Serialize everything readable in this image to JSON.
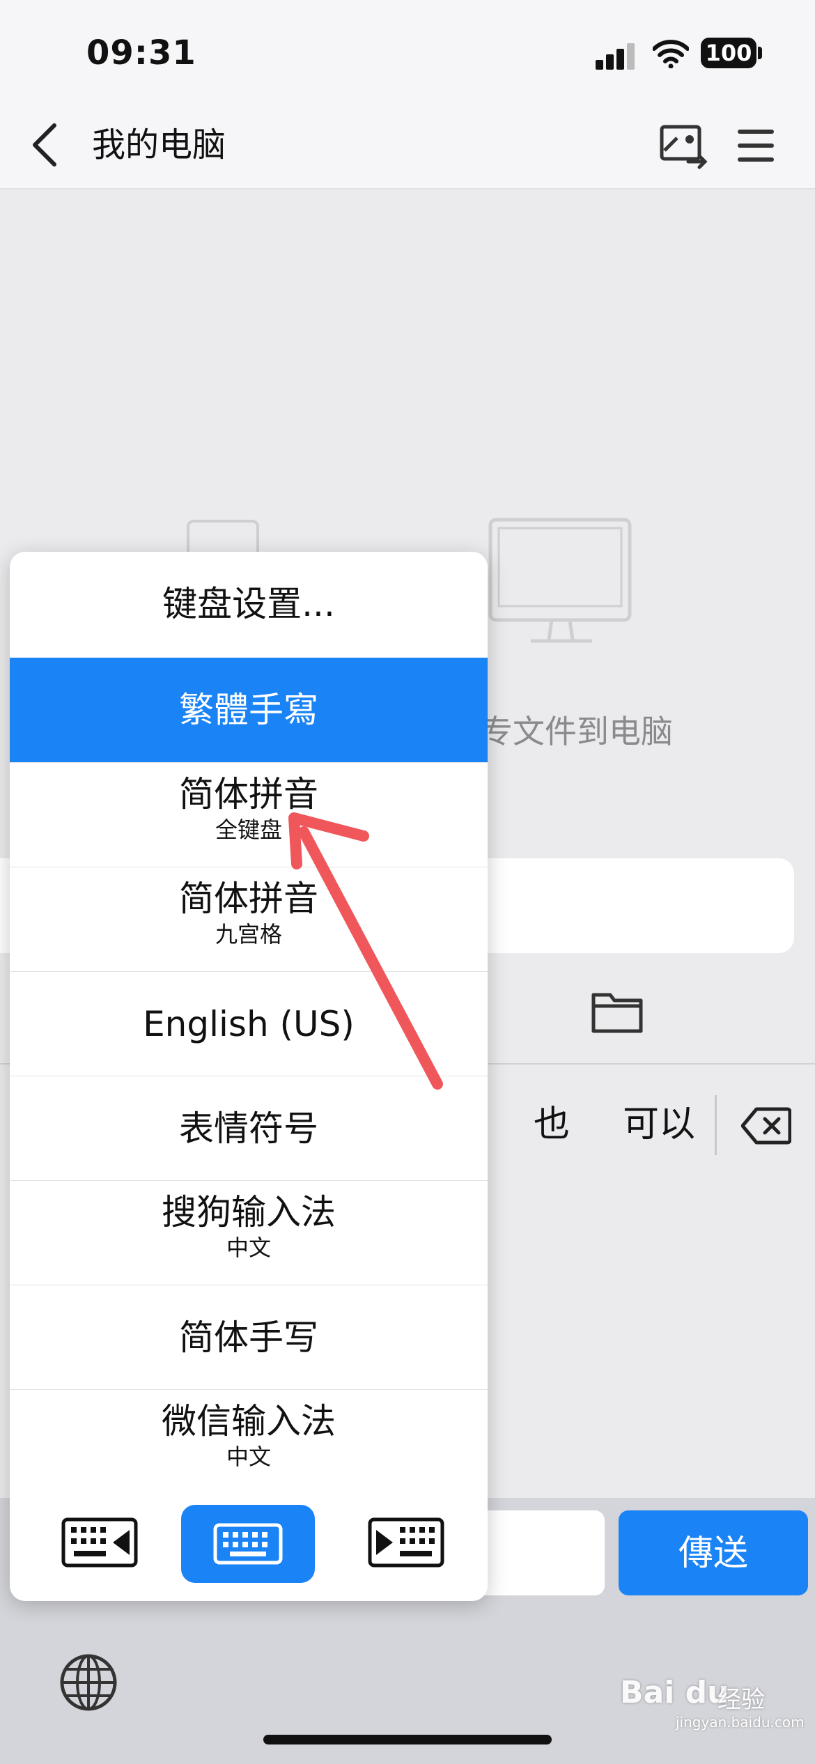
{
  "status_bar": {
    "time": "09:31",
    "battery": "100",
    "icons": [
      "signal-icon",
      "wifi-icon",
      "battery-icon"
    ]
  },
  "nav": {
    "title": "我的电脑",
    "back_icon": "chevron-left-icon",
    "right_icons": [
      "screen-share-icon",
      "menu-icon"
    ]
  },
  "content": {
    "hint_visible_text": "专文件到电脑",
    "device_icons": [
      "tablet-icon",
      "monitor-icon"
    ],
    "folder_icon": "folder-icon"
  },
  "ime_menu": {
    "settings": "键盘设置...",
    "items": [
      {
        "label": "繁體手寫",
        "sub": "",
        "selected": true
      },
      {
        "label": "简体拼音",
        "sub": "全键盘",
        "selected": false
      },
      {
        "label": "简体拼音",
        "sub": "九宫格",
        "selected": false
      },
      {
        "label": "English (US)",
        "sub": "",
        "selected": false
      },
      {
        "label": "表情符号",
        "sub": "",
        "selected": false
      },
      {
        "label": "搜狗输入法",
        "sub": "中文",
        "selected": false
      },
      {
        "label": "简体手写",
        "sub": "",
        "selected": false
      },
      {
        "label": "微信输入法",
        "sub": "中文",
        "selected": false
      }
    ],
    "keyboard_modes": [
      "keyboard-left-icon",
      "keyboard-full-icon",
      "keyboard-right-icon"
    ]
  },
  "candidates": [
    "也",
    "可以"
  ],
  "send_button": "傳送",
  "accent_color": "#1a83f5",
  "annotation_color": "#f0575b",
  "watermark": {
    "brand": "Bai du",
    "sub": "经验",
    "url": "jingyan.baidu.com"
  }
}
